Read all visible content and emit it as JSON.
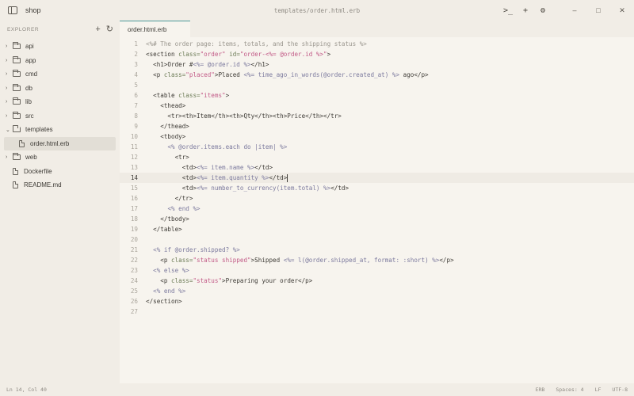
{
  "window": {
    "app_name": "shop",
    "title": "templates/order.html.erb",
    "buttons": {
      "terminal": ">_",
      "new": "+",
      "settings": "⚙"
    },
    "controls": {
      "minimize": "–",
      "maximize": "□",
      "close": "✕"
    }
  },
  "sidebar": {
    "title": "EXPLORER",
    "actions": {
      "new_file": "+",
      "refresh": "↻"
    },
    "items": [
      {
        "label": "api",
        "kind": "folder",
        "open": false,
        "depth": 0
      },
      {
        "label": "app",
        "kind": "folder",
        "open": false,
        "depth": 0
      },
      {
        "label": "cmd",
        "kind": "folder",
        "open": false,
        "depth": 0
      },
      {
        "label": "db",
        "kind": "folder",
        "open": false,
        "depth": 0
      },
      {
        "label": "lib",
        "kind": "folder",
        "open": false,
        "depth": 0
      },
      {
        "label": "src",
        "kind": "folder",
        "open": false,
        "depth": 0
      },
      {
        "label": "templates",
        "kind": "folder",
        "open": true,
        "depth": 0
      },
      {
        "label": "order.html.erb",
        "kind": "file",
        "active": true,
        "depth": 1
      },
      {
        "label": "web",
        "kind": "folder",
        "open": false,
        "depth": 0
      },
      {
        "label": "Dockerfile",
        "kind": "file",
        "depth": 0
      },
      {
        "label": "README.md",
        "kind": "file",
        "depth": 0
      }
    ]
  },
  "editor": {
    "tab_label": "order.html.erb",
    "current_line": 14,
    "lines": [
      [
        [
          "<%# The order page: items, totals, and the shipping status %>",
          "cmt"
        ]
      ],
      [
        [
          "<section ",
          "tag"
        ],
        [
          "class=",
          "attr"
        ],
        [
          "\"order\"",
          "str"
        ],
        [
          " ",
          "tag"
        ],
        [
          "id=",
          "attr"
        ],
        [
          "\"order-<%= @order.id %>\"",
          "str"
        ],
        [
          ">",
          "tag"
        ]
      ],
      [
        [
          "  <h1>Order #",
          "tag"
        ],
        [
          "<%= @order.id %>",
          "erb"
        ],
        [
          "</h1>",
          "tag"
        ]
      ],
      [
        [
          "  <p ",
          "tag"
        ],
        [
          "class=",
          "attr"
        ],
        [
          "\"placed\"",
          "str"
        ],
        [
          ">Placed ",
          "tag"
        ],
        [
          "<%= time_ago_in_words(@order.created_at) %>",
          "erb"
        ],
        [
          " ago</p>",
          "tag"
        ]
      ],
      [],
      [
        [
          "  <table ",
          "tag"
        ],
        [
          "class=",
          "attr"
        ],
        [
          "\"items\"",
          "str"
        ],
        [
          ">",
          "tag"
        ]
      ],
      [
        [
          "    <thead>",
          "tag"
        ]
      ],
      [
        [
          "      <tr><th>Item</th><th>Qty</th><th>Price</th></tr>",
          "tag"
        ]
      ],
      [
        [
          "    </thead>",
          "tag"
        ]
      ],
      [
        [
          "    <tbody>",
          "tag"
        ]
      ],
      [
        [
          "      ",
          "tag"
        ],
        [
          "<% @order.items.each do |item| %>",
          "erb"
        ]
      ],
      [
        [
          "        <tr>",
          "tag"
        ]
      ],
      [
        [
          "          <td>",
          "tag"
        ],
        [
          "<%= item.name %>",
          "erb"
        ],
        [
          "</td>",
          "tag"
        ]
      ],
      [
        [
          "          <td>",
          "tag"
        ],
        [
          "<%= item.quantity %>",
          "erb"
        ],
        [
          "</td>",
          "tag"
        ]
      ],
      [
        [
          "          <td>",
          "tag"
        ],
        [
          "<%= number_to_currency(item.total) %>",
          "erb"
        ],
        [
          "</td>",
          "tag"
        ]
      ],
      [
        [
          "        </tr>",
          "tag"
        ]
      ],
      [
        [
          "      ",
          "tag"
        ],
        [
          "<% end %>",
          "erb"
        ]
      ],
      [
        [
          "    </tbody>",
          "tag"
        ]
      ],
      [
        [
          "  </table>",
          "tag"
        ]
      ],
      [],
      [
        [
          "  ",
          "tag"
        ],
        [
          "<% if @order.shipped? %>",
          "erb"
        ]
      ],
      [
        [
          "    <p ",
          "tag"
        ],
        [
          "class=",
          "attr"
        ],
        [
          "\"status shipped\"",
          "str"
        ],
        [
          ">Shipped ",
          "tag"
        ],
        [
          "<%= l(@order.shipped_at, format: :short) %>",
          "erb"
        ],
        [
          "</p>",
          "tag"
        ]
      ],
      [
        [
          "  ",
          "tag"
        ],
        [
          "<% else %>",
          "erb"
        ]
      ],
      [
        [
          "    <p ",
          "tag"
        ],
        [
          "class=",
          "attr"
        ],
        [
          "\"status\"",
          "str"
        ],
        [
          ">Preparing your order</p>",
          "tag"
        ]
      ],
      [
        [
          "  ",
          "tag"
        ],
        [
          "<% end %>",
          "erb"
        ]
      ],
      [
        [
          "</section>",
          "tag"
        ]
      ],
      []
    ]
  },
  "statusbar": {
    "position": "Ln 14, Col 40",
    "language": "ERB",
    "indent": "Spaces: 4",
    "eol": "LF",
    "encoding": "UTF-8"
  }
}
